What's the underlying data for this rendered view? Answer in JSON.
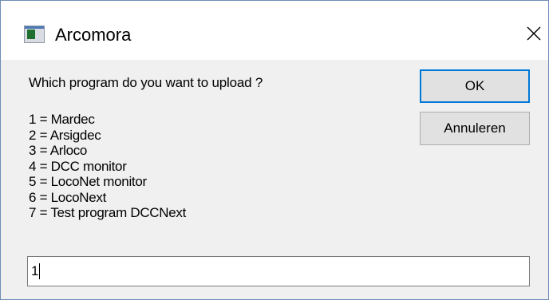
{
  "window": {
    "title": "Arcomora",
    "app_icon": "app-window-icon",
    "close_icon": "close-icon"
  },
  "dialog": {
    "prompt": "Which program do you want to upload ?",
    "options": [
      "1 = Mardec",
      "2 = Arsigdec",
      "3 = Arloco",
      "4 = DCC monitor",
      "5 = LocoNet monitor",
      "6 = LocoNext",
      "7 = Test program DCCNext"
    ],
    "input_value": "1"
  },
  "buttons": {
    "ok_label": "OK",
    "cancel_label": "Annuleren"
  },
  "colors": {
    "focus_accent": "#0078d7",
    "dialog_background": "#f0f0f0",
    "titlebar_background": "#ffffff"
  }
}
